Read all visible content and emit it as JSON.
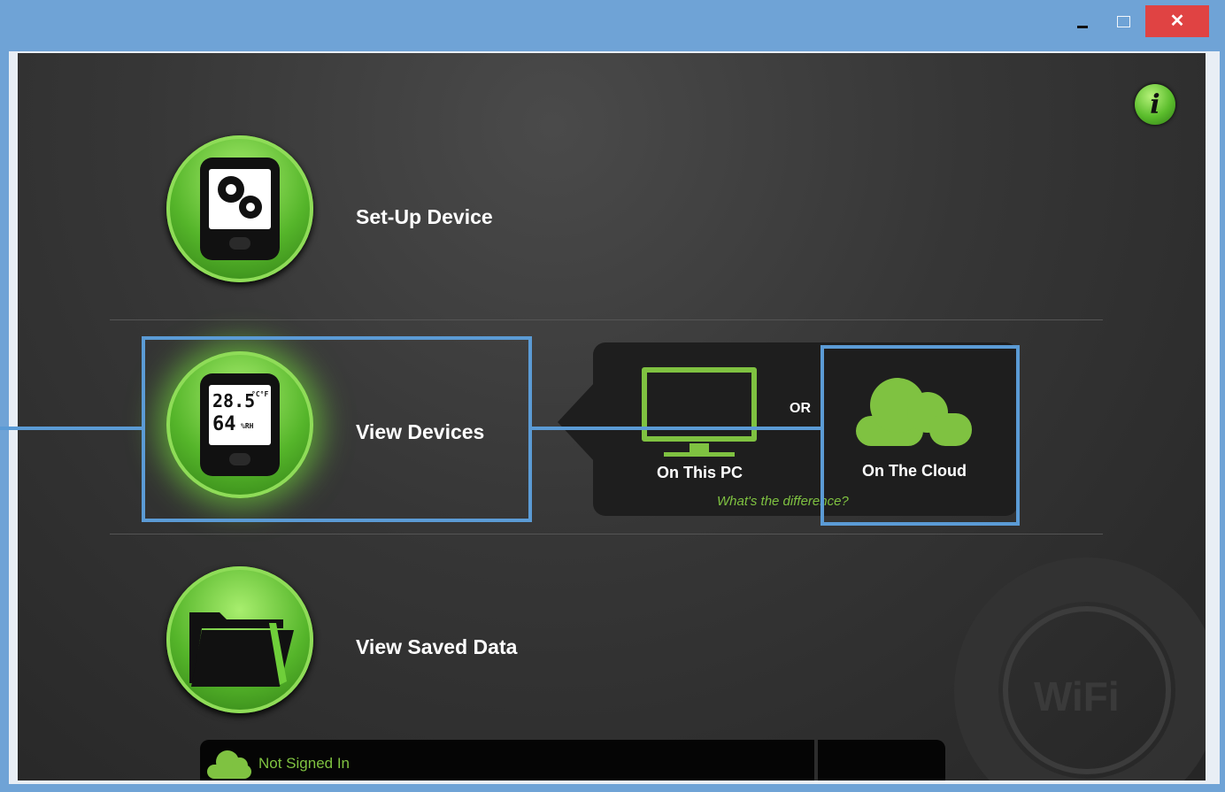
{
  "window": {
    "minimize_glyph": "",
    "maximize_glyph": "",
    "close_glyph": "✕"
  },
  "info_button": {
    "glyph": "i"
  },
  "menu": {
    "setup": {
      "label": "Set-Up Device"
    },
    "view_devices": {
      "label": "View Devices",
      "lcd_temp": "28.5",
      "lcd_temp_unit": "°C°F",
      "lcd_rh": "64",
      "lcd_rh_unit": "%RH"
    },
    "saved": {
      "label": "View Saved Data"
    }
  },
  "view_options": {
    "pc_label": "On This PC",
    "or_label": "OR",
    "cloud_label": "On The Cloud",
    "difference_link": "What's the difference?"
  },
  "watermark": {
    "text": "WiFi"
  },
  "status": {
    "sign_in_text": "Not Signed In"
  },
  "colors": {
    "accent_green": "#7fc241",
    "highlight_blue": "#5b9bd5",
    "close_red": "#e04343",
    "titlebar": "#6fa3d6"
  }
}
